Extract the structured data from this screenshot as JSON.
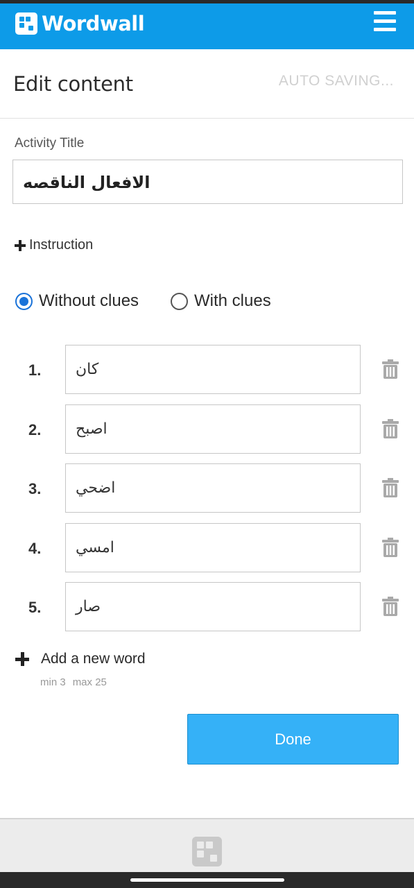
{
  "app": {
    "name": "Wordwall"
  },
  "header": {
    "title": "Edit content",
    "status": "AUTO SAVING..."
  },
  "activity": {
    "label": "Activity Title",
    "value": "الافعال الناقصه"
  },
  "instruction": {
    "label": "Instruction"
  },
  "clue_mode": {
    "options": [
      {
        "label": "Without clues",
        "selected": true
      },
      {
        "label": "With clues",
        "selected": false
      }
    ]
  },
  "words": [
    {
      "number": "1.",
      "value": "كان"
    },
    {
      "number": "2.",
      "value": "اصبح"
    },
    {
      "number": "3.",
      "value": "اضحي"
    },
    {
      "number": "4.",
      "value": "امسي"
    },
    {
      "number": "5.",
      "value": "صار"
    }
  ],
  "add_word": {
    "label": "Add a new word",
    "min": "min 3",
    "max": "max 25"
  },
  "done": {
    "label": "Done"
  },
  "colors": {
    "brand": "#0d9be8",
    "button": "#35b1f7",
    "radio": "#1a73d9"
  },
  "icons": {
    "menu": "hamburger-icon",
    "delete": "trash-icon",
    "add": "plus-icon",
    "logo": "wordwall-logo-icon"
  }
}
